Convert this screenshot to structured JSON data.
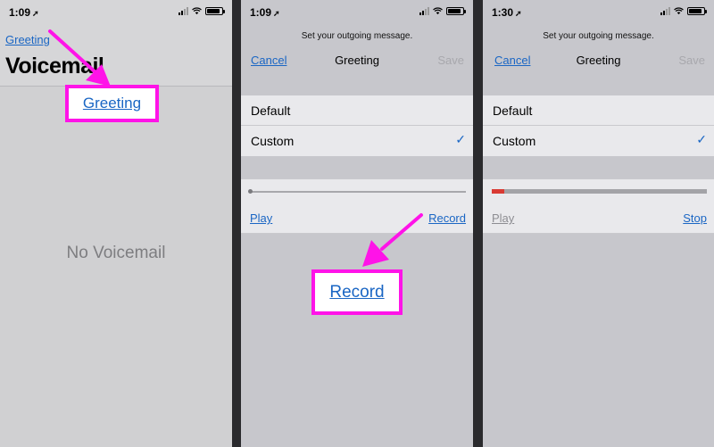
{
  "panel1": {
    "status": {
      "time": "1:09"
    },
    "back_link": "Greeting",
    "title": "Voicemail",
    "empty_message": "No Voicemail",
    "highlight_label": "Greeting"
  },
  "panel2": {
    "status": {
      "time": "1:09"
    },
    "subtitle": "Set your outgoing message.",
    "nav": {
      "cancel": "Cancel",
      "title": "Greeting",
      "save": "Save"
    },
    "options": [
      {
        "label": "Default",
        "selected": false
      },
      {
        "label": "Custom",
        "selected": true
      }
    ],
    "play_label": "Play",
    "record_label": "Record",
    "highlight_label": "Record"
  },
  "panel3": {
    "status": {
      "time": "1:30"
    },
    "subtitle": "Set your outgoing message.",
    "nav": {
      "cancel": "Cancel",
      "title": "Greeting",
      "save": "Save"
    },
    "options": [
      {
        "label": "Default",
        "selected": false
      },
      {
        "label": "Custom",
        "selected": true
      }
    ],
    "play_label": "Play",
    "stop_label": "Stop",
    "recording_progress": 0.06
  },
  "icons": {
    "location": "location-arrow-icon",
    "cellular": "cellular-signal-icon",
    "wifi": "wifi-icon",
    "battery": "battery-icon",
    "checkmark": "checkmark-icon"
  },
  "colors": {
    "highlight": "#ff13e8",
    "link": "#1a66c4",
    "recording": "#d93a33"
  }
}
